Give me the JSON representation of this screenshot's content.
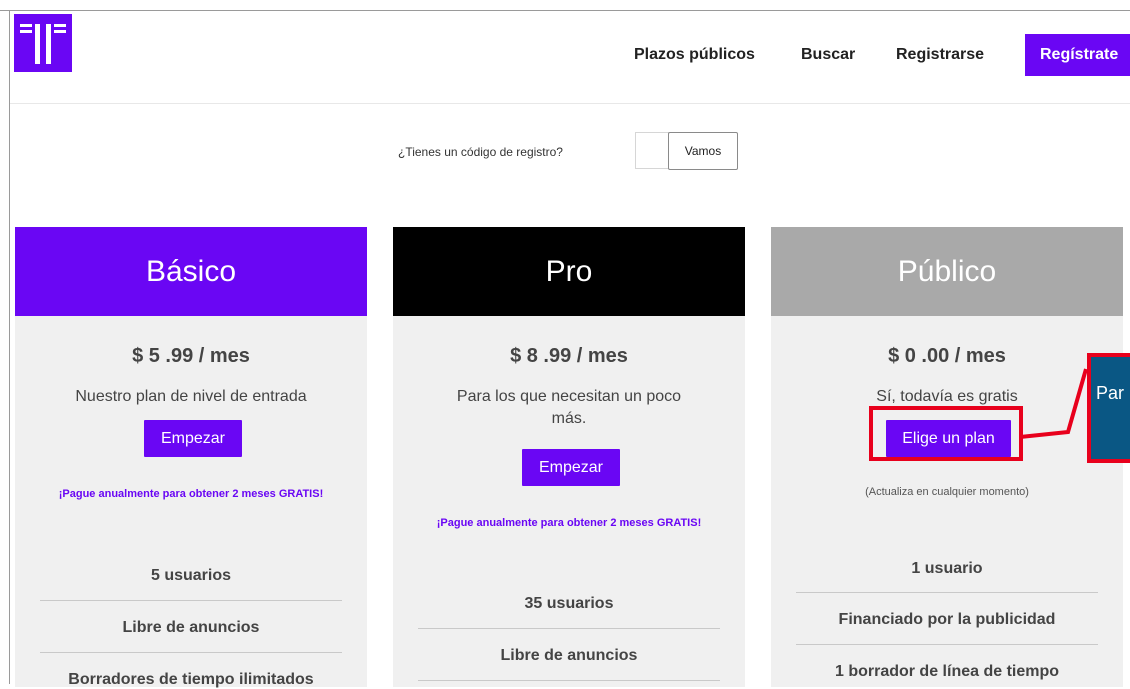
{
  "header": {
    "nav": [
      "Plazos públicos",
      "Buscar",
      "Registrarse"
    ],
    "cta_label": "Regístrate"
  },
  "registration": {
    "question": "¿Tienes un código de registro?",
    "code_value": "",
    "submit_label": "Vamos"
  },
  "plans": [
    {
      "name": "Básico",
      "price": "$ 5 .99  /  mes",
      "tagline": "Nuestro plan de nivel de entrada",
      "button": "Empezar",
      "promo": "¡Pague anualmente para obtener 2 meses GRATIS!",
      "features": [
        "5 usuarios",
        "Libre de anuncios",
        "Borradores de tiempo ilimitados"
      ]
    },
    {
      "name": "Pro",
      "price": "$ 8 .99  /  mes",
      "tagline": "Para los que necesitan un poco más.",
      "button": "Empezar",
      "promo": "¡Pague anualmente para obtener 2 meses GRATIS!",
      "features": [
        "35 usuarios",
        "Libre de anuncios"
      ]
    },
    {
      "name": "Público",
      "price": "$ 0 .00  /  mes",
      "tagline": "Sí, todavía es gratis",
      "button": "Elige un plan",
      "note": "(Actualiza en cualquier momento)",
      "features": [
        "1 usuario",
        "Financiado por la publicidad",
        "1 borrador de línea de tiempo"
      ]
    }
  ],
  "tooltip": {
    "text": "Par"
  },
  "colors": {
    "brand": "#6a06f4",
    "pro_header": "#000000",
    "public_header": "#a9a9a9",
    "card_bg": "#f0f0f0",
    "highlight": "#e8001c",
    "tooltip_bg": "#0a5784"
  },
  "icons": {
    "logo": "brand-logo-icon"
  }
}
